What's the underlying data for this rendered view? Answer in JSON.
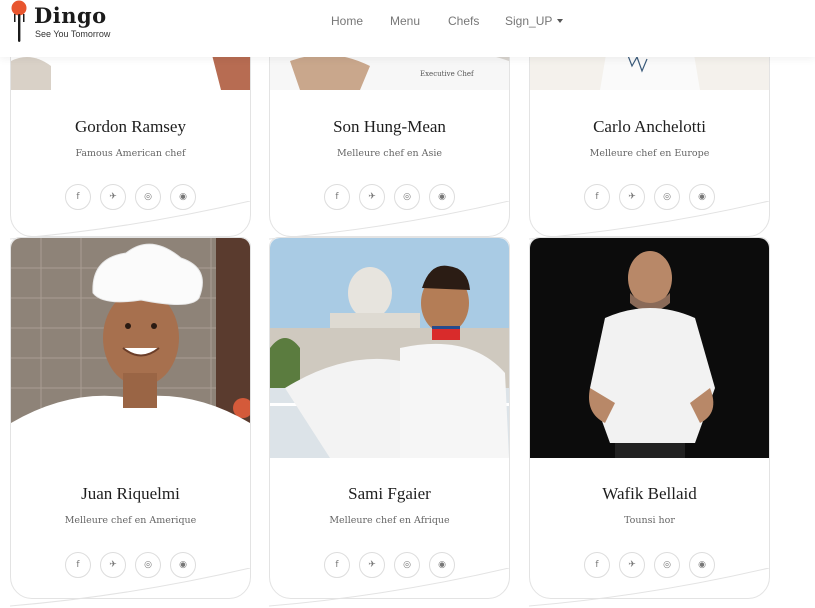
{
  "brand": {
    "name": "Dingo",
    "tagline": "See You Tomorrow",
    "accent": "#e8552e"
  },
  "nav": {
    "items": [
      {
        "label": "Home"
      },
      {
        "label": "Menu"
      },
      {
        "label": "Chefs"
      },
      {
        "label": "Sign_UP"
      }
    ]
  },
  "social_icons": [
    "facebook-icon",
    "twitter-icon",
    "instagram-icon",
    "dribbble-icon"
  ],
  "social_glyphs": [
    "f",
    "✈",
    "◎",
    "◉"
  ],
  "chefs": [
    {
      "name": "Gordon Ramsey",
      "role": "Famous American chef"
    },
    {
      "name": "Son Hung-Mean",
      "role": "Melleure chef en Asie"
    },
    {
      "name": "Carlo Anchelotti",
      "role": "Melleure chef en Europe"
    },
    {
      "name": "Juan Riquelmi",
      "role": "Melleure chef en Amerique"
    },
    {
      "name": "Sami Fgaier",
      "role": "Melleure chef en Afrique"
    },
    {
      "name": "Wafik Bellaid",
      "role": "Tounsi hor"
    }
  ]
}
